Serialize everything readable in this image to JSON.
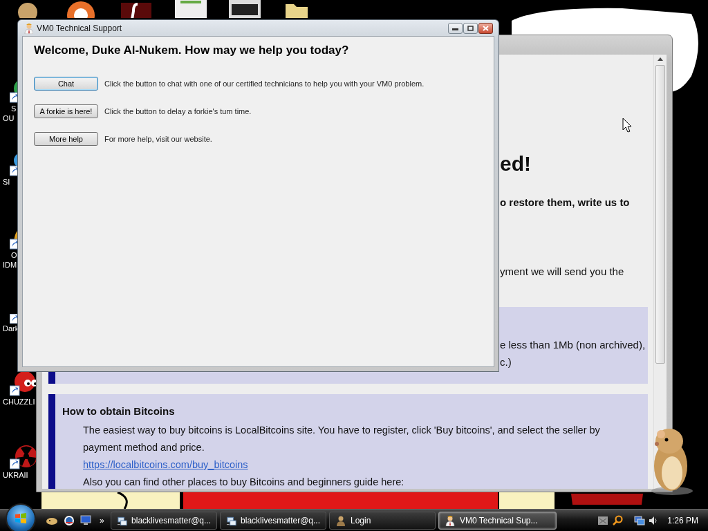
{
  "desktop_icons": [
    {
      "kind": "orb",
      "lines": [
        "S",
        "OU"
      ]
    },
    {
      "kind": "bird",
      "lines": [
        "SI"
      ]
    },
    {
      "kind": "chart",
      "lines": [
        "O",
        "IDM"
      ]
    },
    {
      "kind": "blank",
      "lines": [
        "Dark"
      ]
    },
    {
      "kind": "furball",
      "lines": [
        "CHUZZLI"
      ]
    },
    {
      "kind": "hazard",
      "lines": [
        "UKRAII"
      ]
    }
  ],
  "background_window": {
    "heading_fragment": "ed!",
    "bold_fragment": "o restore them, write us to",
    "text_fragment": "yment we will send you the",
    "notice_box": {
      "lines": [
        "e less than 1Mb (non archived),",
        "c.)"
      ]
    },
    "bitcoin_box": {
      "title": "How to obtain Bitcoins",
      "paragraph": "The easiest way to buy bitcoins is LocalBitcoins site. You have to register, click 'Buy bitcoins', and select the seller by payment method and price.",
      "link": "https://localbitcoins.com/buy_bitcoins",
      "note": "Also you can find other places to buy Bitcoins and beginners guide here:"
    }
  },
  "support_window": {
    "title": "VM0 Technical Support",
    "heading": "Welcome, Duke Al-Nukem. How may we help you today?",
    "actions": [
      {
        "button": "Chat",
        "description": "Click the button to chat with one of our certified technicians to help you with your VM0 problem.",
        "focused": true
      },
      {
        "button": "A forkie is here!",
        "description": "Click the button to delay a forkie's tum time.",
        "focused": false
      },
      {
        "button": "More help",
        "description": "For more help, visit our website.",
        "focused": false
      }
    ]
  },
  "taskbar": {
    "overflow_chevron": "»",
    "tasks": [
      {
        "kind": "network",
        "label": "blacklivesmatter@q...",
        "selected": false
      },
      {
        "kind": "network",
        "label": "blacklivesmatter@q...",
        "selected": false
      },
      {
        "kind": "user",
        "label": "Login",
        "selected": false
      },
      {
        "kind": "support",
        "label": "VM0 Technical Sup...",
        "selected": true
      }
    ],
    "clock": "1:26 PM"
  }
}
